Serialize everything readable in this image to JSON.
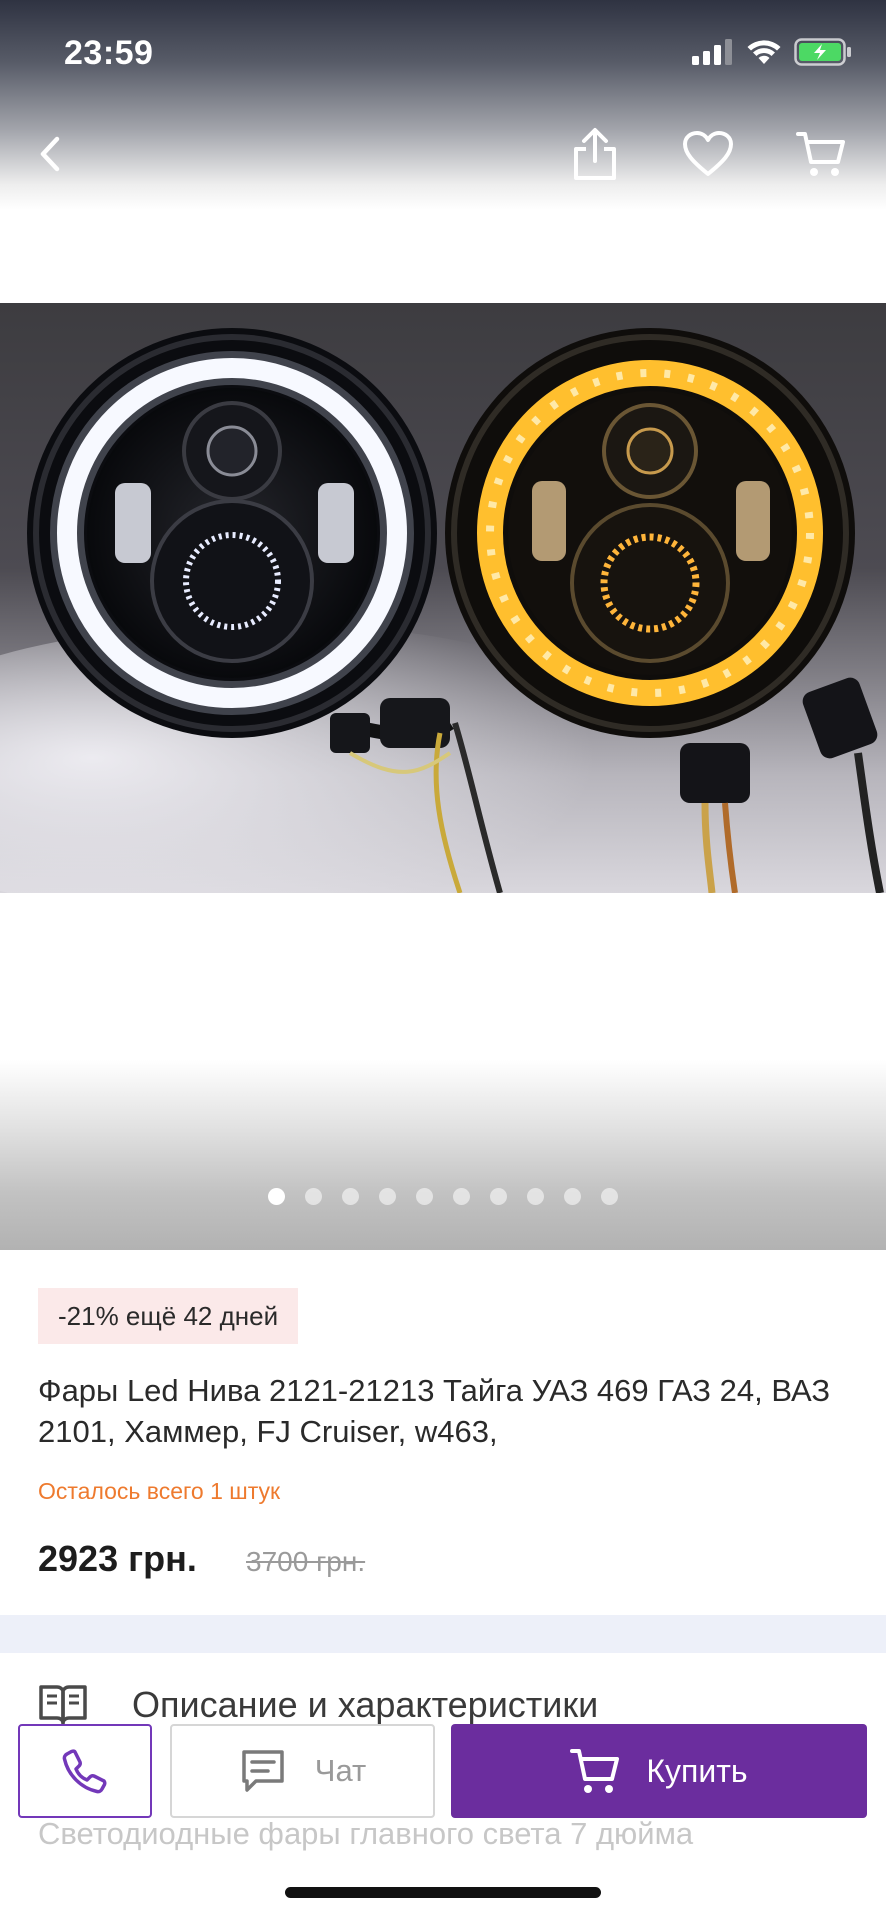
{
  "status_bar": {
    "time": "23:59",
    "icons": [
      "cellular-signal-icon",
      "wifi-icon",
      "battery-charging-icon"
    ]
  },
  "nav": {
    "icons": [
      "back-arrow-icon",
      "share-icon",
      "heart-icon",
      "cart-icon"
    ]
  },
  "gallery": {
    "image_alt": "LED headlights",
    "dot_count": 10,
    "active_index": 0
  },
  "product": {
    "discount_badge": "-21% ещё 42 дней",
    "title": "Фары Led Нива 2121-21213 Тайга УАЗ 469 ГАЗ 24, ВАЗ 2101, Хаммер, FJ Cruiser, w463,",
    "stock": "Осталось всего 1 штук",
    "price": "2923 грн.",
    "old_price": "3700 грн."
  },
  "description": {
    "heading": "Описание и характеристики",
    "preview": "Светодиодные фары главного света 7 дюйма"
  },
  "actions": {
    "chat_label": "Чат",
    "buy_label": "Купить"
  },
  "colors": {
    "accent": "#6b2d9e",
    "stock": "#ee7a2e",
    "badge_bg": "#fbe9e9",
    "separator": "#edf0f9"
  }
}
